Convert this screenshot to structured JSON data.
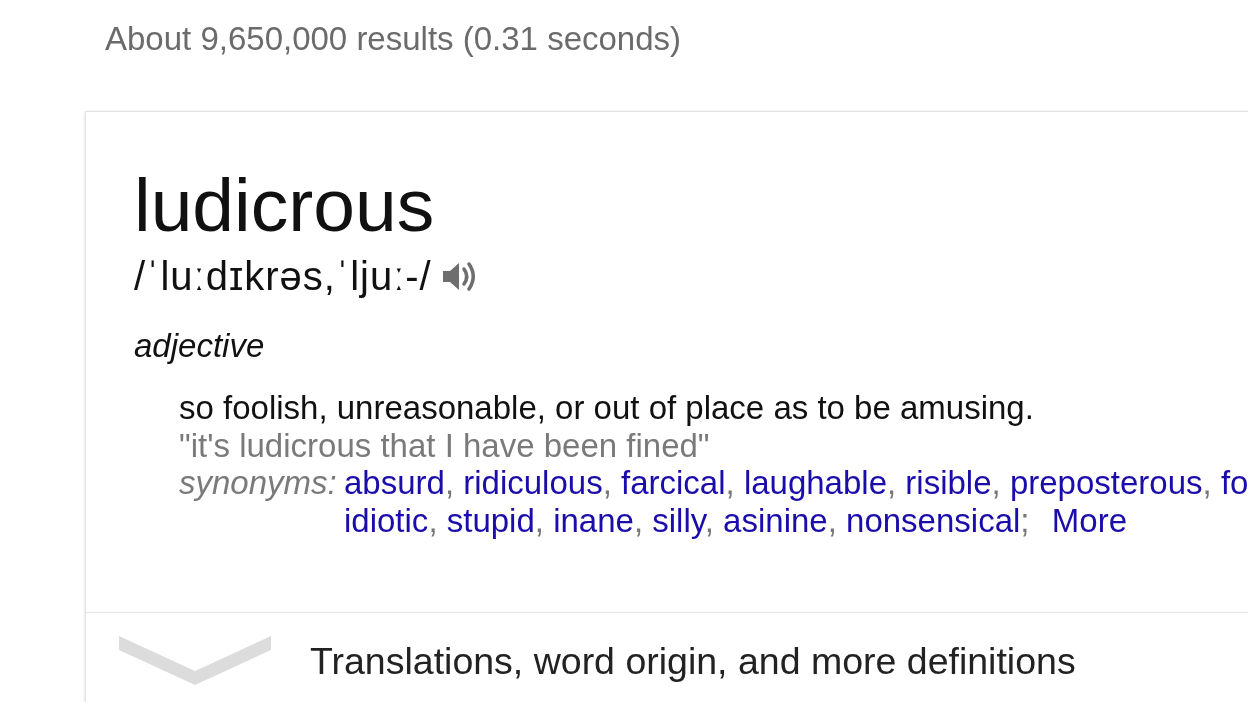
{
  "result_stats": "About 9,650,000 results (0.31 seconds)",
  "definition_card": {
    "headword": "ludicrous",
    "pronunciation": "/ˈluːdɪkrəs,ˈljuː-/",
    "part_of_speech": "adjective",
    "senses": [
      {
        "definition": "so foolish, unreasonable, or out of place as to be amusing.",
        "example": "\"it's ludicrous that I have been fined\"",
        "synonyms_label": "synonyms:",
        "synonym_lines": [
          [
            {
              "word": "absurd",
              "separator": ","
            },
            {
              "word": "ridiculous",
              "separator": ","
            },
            {
              "word": "farcical",
              "separator": ","
            },
            {
              "word": "laughable",
              "separator": ","
            },
            {
              "word": "risible",
              "separator": ","
            },
            {
              "word": "preposterous",
              "separator": ","
            },
            {
              "word": "fo"
            }
          ],
          [
            {
              "word": "idiotic",
              "separator": ","
            },
            {
              "word": "stupid",
              "separator": ","
            },
            {
              "word": "inane",
              "separator": ","
            },
            {
              "word": "silly",
              "separator": ","
            },
            {
              "word": "asinine",
              "separator": ","
            },
            {
              "word": "nonsensical",
              "separator": ";"
            }
          ]
        ],
        "more_link": "More"
      }
    ],
    "expand_row": {
      "label": "Translations, word origin, and more definitions",
      "expanded": false
    }
  }
}
